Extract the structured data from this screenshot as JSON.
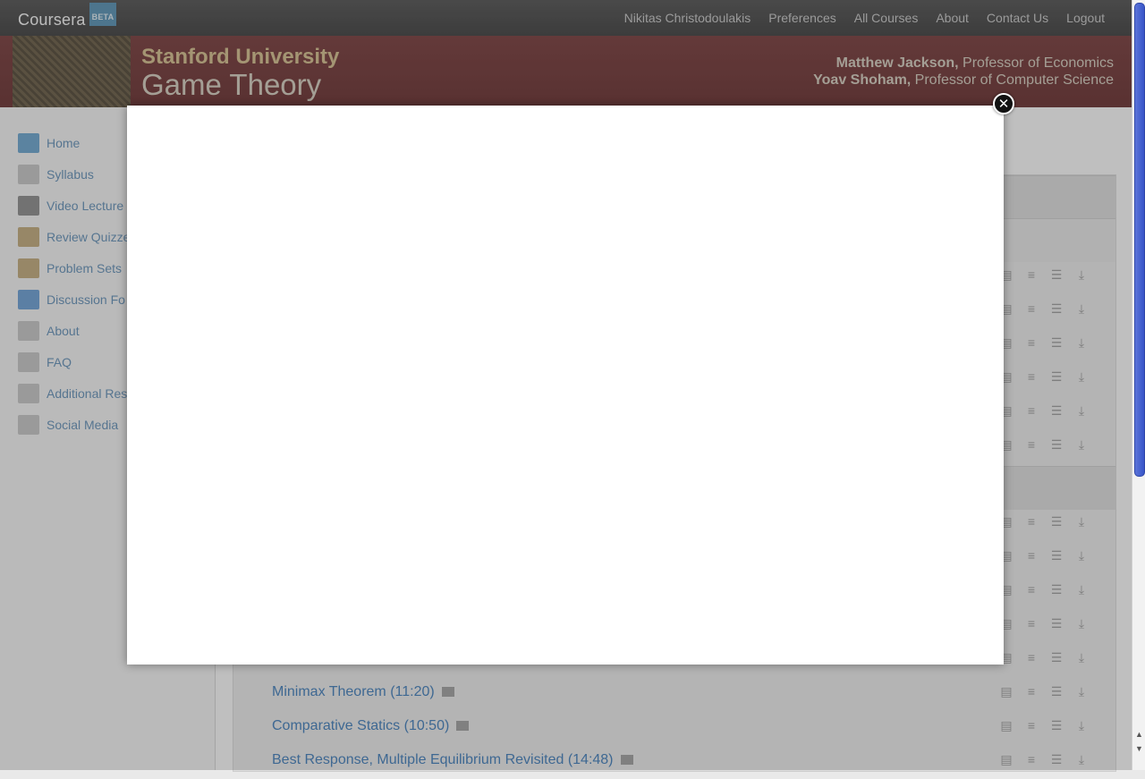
{
  "topbar": {
    "brand": "Coursera",
    "badge": "BETA",
    "nav": [
      "Nikitas Christodoulakis",
      "Preferences",
      "All Courses",
      "About",
      "Contact Us",
      "Logout"
    ]
  },
  "banner": {
    "university": "Stanford University",
    "course": "Game Theory",
    "professors": [
      {
        "name": "Matthew Jackson,",
        "title": " Professor of Economics"
      },
      {
        "name": "Yoav Shoham,",
        "title": " Professor of Computer Science"
      }
    ]
  },
  "sidebar": {
    "items": [
      {
        "label": "Home",
        "icon": "home-icon"
      },
      {
        "label": "Syllabus",
        "icon": "document-icon"
      },
      {
        "label": "Video Lecture",
        "icon": "video-icon"
      },
      {
        "label": "Review Quizze",
        "icon": "quiz-icon"
      },
      {
        "label": "Problem Sets",
        "icon": "quiz-icon"
      },
      {
        "label": "Discussion Fo",
        "icon": "discussion-icon"
      },
      {
        "label": "About",
        "icon": "document-icon"
      },
      {
        "label": "FAQ",
        "icon": "document-icon"
      },
      {
        "label": "Additional Res",
        "icon": "document-icon"
      },
      {
        "label": "Social Media",
        "icon": "document-icon"
      }
    ]
  },
  "lectures": {
    "visible": [
      {
        "title": "Minimax Theorem (11:20)"
      },
      {
        "title": "Comparative Statics (10:50)"
      },
      {
        "title": "Best Response, Multiple Equilibrium Revisited (14:48)"
      }
    ]
  },
  "modal": {
    "close_icon": "close-icon"
  },
  "colors": {
    "link": "#4c7fb3",
    "topbar": "#4f4f4f",
    "banner": "#7a4747",
    "modal_bg": "#ffffff"
  }
}
